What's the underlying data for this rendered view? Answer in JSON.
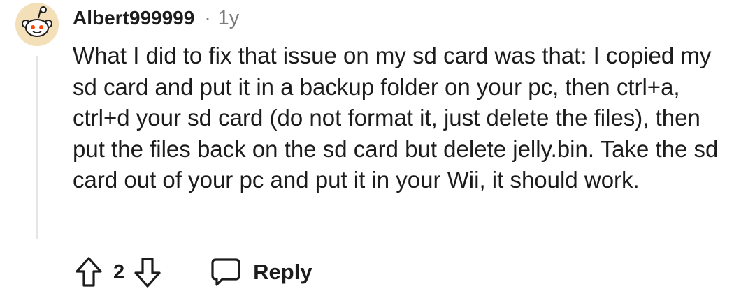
{
  "comment": {
    "author": "Albert999999",
    "separator": "·",
    "age": "1y",
    "body": "What I did to fix that issue on my sd card was that: I copied my sd card and put it in a backup folder on your pc, then ctrl+a, ctrl+d your sd card (do not format it, just delete the files), then put the files back on the sd card but delete jelly.bin. Take the sd card out of your pc and put it in your Wii, it should work.",
    "avatar_icon": "snoo-avatar-icon",
    "avatar_bg": "#f3dfb8"
  },
  "actions": {
    "upvote_icon": "upvote-arrow-icon",
    "score": "2",
    "downvote_icon": "downvote-arrow-icon",
    "reply_icon": "speech-bubble-icon",
    "reply_label": "Reply"
  }
}
